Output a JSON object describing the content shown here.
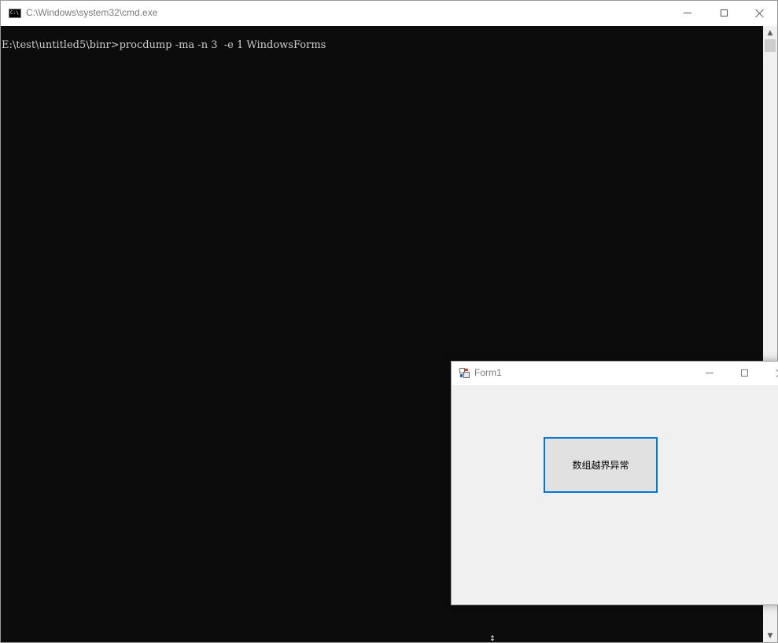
{
  "cmd": {
    "title": "C:\\Windows\\system32\\cmd.exe",
    "icon": "console-icon",
    "prompt_line": "E:\\test\\untitled5\\binr>procdump -ma -n 3  -e 1 WindowsForms",
    "window_controls": {
      "minimize": "minimize-icon",
      "maximize": "maximize-icon",
      "close": "close-icon"
    },
    "scrollbar": {
      "up": "▲",
      "down": "▼"
    },
    "colors": {
      "background": "#0c0c0c",
      "text": "#cccccc"
    }
  },
  "form1": {
    "title": "Form1",
    "icon": "form-app-icon",
    "button_label": "数组越界异常",
    "colors": {
      "client": "#f0f0f0",
      "button_border": "#0078d7",
      "button_fill": "#e1e1e1"
    }
  },
  "cursor": {
    "glyph": "↕"
  }
}
